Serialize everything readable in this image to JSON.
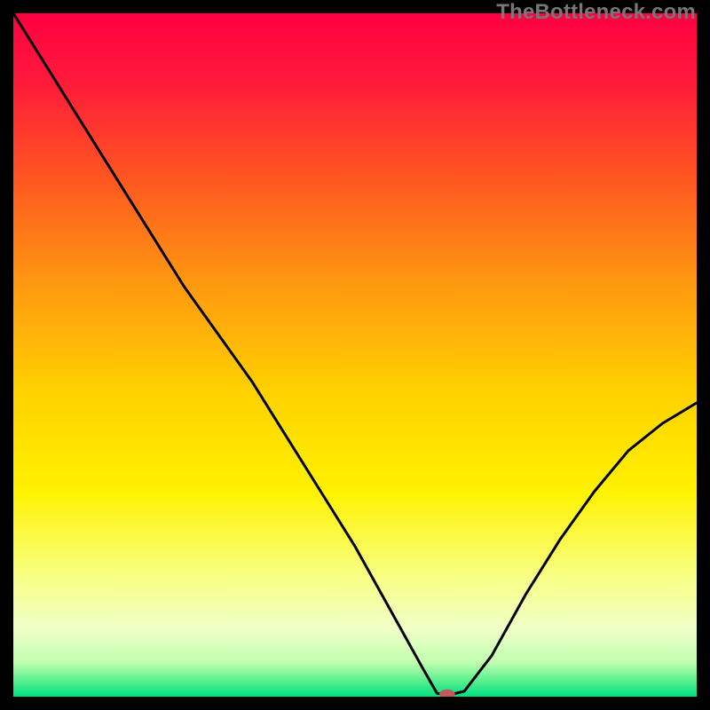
{
  "watermark": "TheBottleneck.com",
  "chart_data": {
    "type": "line",
    "title": "",
    "xlabel": "",
    "ylabel": "",
    "xlim": [
      0,
      100
    ],
    "ylim": [
      0,
      100
    ],
    "x": [
      0,
      5,
      10,
      15,
      20,
      25,
      30,
      35,
      40,
      45,
      50,
      55,
      60,
      62,
      63,
      64,
      66,
      70,
      75,
      80,
      85,
      90,
      95,
      100
    ],
    "values": [
      100,
      92,
      84,
      76,
      68,
      60,
      53,
      46,
      38,
      30,
      22,
      13,
      4,
      0.5,
      0.3,
      0.3,
      0.8,
      6,
      15,
      23,
      30,
      36,
      40,
      43
    ],
    "marker": {
      "x": 63.5,
      "y": 0.3
    },
    "gradient_stops": [
      {
        "offset": 0.0,
        "color": "#ff0042"
      },
      {
        "offset": 0.1,
        "color": "#ff1a3a"
      },
      {
        "offset": 0.25,
        "color": "#ff5a20"
      },
      {
        "offset": 0.4,
        "color": "#ff9a10"
      },
      {
        "offset": 0.55,
        "color": "#ffd000"
      },
      {
        "offset": 0.7,
        "color": "#fff200"
      },
      {
        "offset": 0.82,
        "color": "#f8ff80"
      },
      {
        "offset": 0.9,
        "color": "#f0ffc8"
      },
      {
        "offset": 0.95,
        "color": "#c0ffb0"
      },
      {
        "offset": 0.975,
        "color": "#60f090"
      },
      {
        "offset": 1.0,
        "color": "#00e080"
      }
    ],
    "curve_color": "#000000",
    "marker_color": "#c25a5a",
    "background_frame": "#000000"
  }
}
